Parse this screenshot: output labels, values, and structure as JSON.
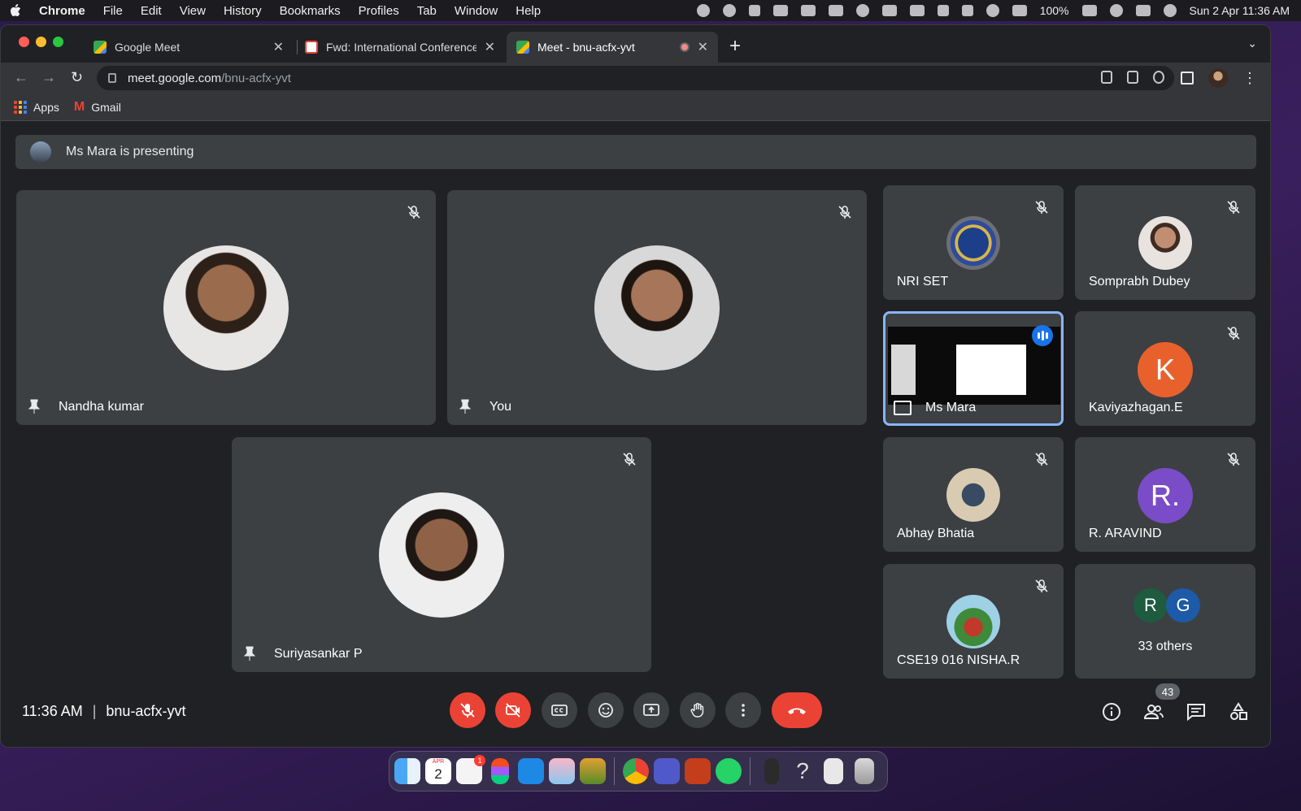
{
  "menubar": {
    "app": "Chrome",
    "items": [
      "File",
      "Edit",
      "View",
      "History",
      "Bookmarks",
      "Profiles",
      "Tab",
      "Window",
      "Help"
    ],
    "battery": "100%",
    "datetime": "Sun 2 Apr  11:36 AM"
  },
  "browser": {
    "tabs": [
      {
        "label": "Google Meet",
        "favicon_color": "#34a853"
      },
      {
        "label": "Fwd: International Conference",
        "favicon_color": "#ea4335"
      },
      {
        "label": "Meet - bnu-acfx-yvt",
        "favicon_color": "#34a853"
      }
    ],
    "url_host": "meet.google.com",
    "url_path": "/bnu-acfx-yvt",
    "bookmarks": [
      {
        "label": "Apps"
      },
      {
        "label": "Gmail"
      }
    ]
  },
  "meet": {
    "presenting_text": "Ms Mara is presenting",
    "main_tiles": [
      {
        "name": "Nandha kumar"
      },
      {
        "name": "You"
      },
      {
        "name": "Suriyasankar P"
      }
    ],
    "side_tiles": [
      {
        "name": "NRI SET"
      },
      {
        "name": "Somprabh Dubey"
      },
      {
        "name": "Ms Mara"
      },
      {
        "name": "Kaviyazhagan.E",
        "initial": "K",
        "color": "#e8612c"
      },
      {
        "name": "Abhay Bhatia"
      },
      {
        "name": "R. ARAVIND",
        "initial": "R.",
        "color": "#7b4cc7"
      },
      {
        "name": "CSE19 016 NISHA.R"
      }
    ],
    "others": {
      "label": "33 others",
      "initials": [
        "R",
        "G"
      ],
      "colors": [
        "#1e5b3f",
        "#1d5aa8"
      ]
    },
    "time": "11:36 AM",
    "separator": "|",
    "meeting_code": "bnu-acfx-yvt",
    "participant_count": "43"
  },
  "dock": {
    "calendar_month": "APR",
    "calendar_day": "2",
    "reminder_badge": "1"
  }
}
